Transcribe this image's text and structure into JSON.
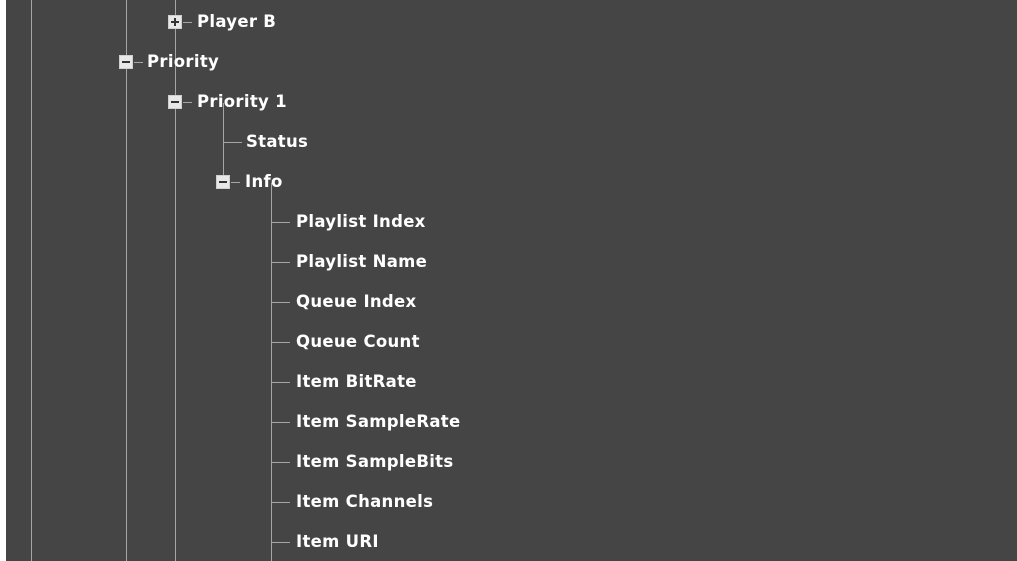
{
  "tree": {
    "player_b": {
      "label": "Player B",
      "expanded": false,
      "icon": "plus-box-icon"
    },
    "priority": {
      "label": "Priority",
      "expanded": true,
      "icon": "minus-box-icon"
    },
    "priority_1": {
      "label": "Priority 1",
      "expanded": true,
      "icon": "minus-box-icon"
    },
    "status": {
      "label": "Status"
    },
    "info": {
      "label": "Info",
      "expanded": true,
      "icon": "minus-box-icon"
    },
    "info_items": [
      {
        "label": "Playlist Index"
      },
      {
        "label": "Playlist Name"
      },
      {
        "label": "Queue Index"
      },
      {
        "label": "Queue Count"
      },
      {
        "label": "Item BitRate"
      },
      {
        "label": "Item SampleRate"
      },
      {
        "label": "Item SampleBits"
      },
      {
        "label": "Item Channels"
      },
      {
        "label": "Item URI"
      }
    ]
  },
  "colors": {
    "background": "#454545",
    "connector": "#a6a6a6",
    "text": "#ffffff",
    "toggle": "#e8e8e8"
  }
}
